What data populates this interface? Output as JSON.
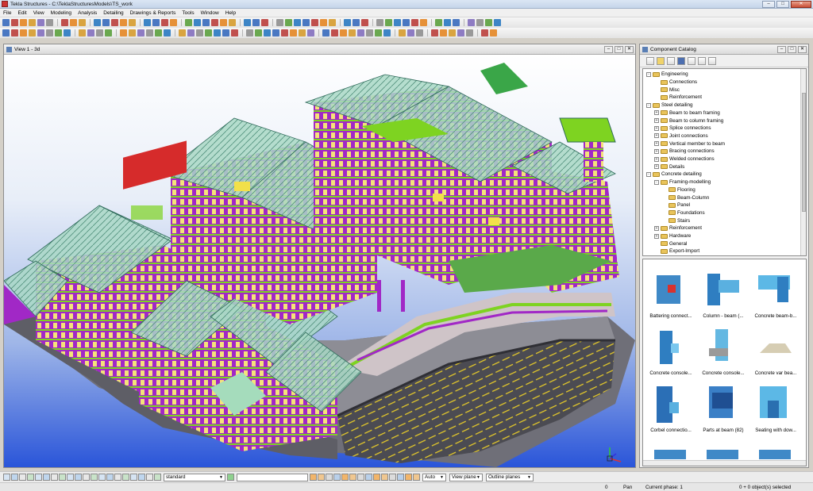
{
  "window": {
    "title": "Tekla Structures - C:\\TeklaStructuresModels\\TS_work",
    "min": "–",
    "max": "□",
    "close": "✕"
  },
  "menu": [
    "File",
    "Edit",
    "View",
    "Modeling",
    "Analysis",
    "Detailing",
    "Drawings & Reports",
    "Tools",
    "Window",
    "Help"
  ],
  "view": {
    "title": "View 1 - 3d"
  },
  "catalog": {
    "title": "Component Catalog",
    "tree": [
      {
        "label": "Engineering",
        "level": 1,
        "exp": "-"
      },
      {
        "label": "Connections",
        "level": 2,
        "exp": ""
      },
      {
        "label": "Misc",
        "level": 2,
        "exp": ""
      },
      {
        "label": "Reinforcement",
        "level": 2,
        "exp": ""
      },
      {
        "label": "Steel detailing",
        "level": 1,
        "exp": "-"
      },
      {
        "label": "Beam to beam framing",
        "level": 2,
        "exp": "+"
      },
      {
        "label": "Beam to column framing",
        "level": 2,
        "exp": "+"
      },
      {
        "label": "Splice connections",
        "level": 2,
        "exp": "+"
      },
      {
        "label": "Joint connections",
        "level": 2,
        "exp": "+"
      },
      {
        "label": "Vertical member to beam",
        "level": 2,
        "exp": "+"
      },
      {
        "label": "Bracing connections",
        "level": 2,
        "exp": "+"
      },
      {
        "label": "Welded connections",
        "level": 2,
        "exp": "+"
      },
      {
        "label": "Details",
        "level": 2,
        "exp": "+"
      },
      {
        "label": "Concrete detailing",
        "level": 1,
        "exp": "-"
      },
      {
        "label": "Framing-modelling",
        "level": 2,
        "exp": "-"
      },
      {
        "label": "Flooring",
        "level": 3,
        "exp": ""
      },
      {
        "label": "Beam-Column",
        "level": 3,
        "exp": ""
      },
      {
        "label": "Panel",
        "level": 3,
        "exp": ""
      },
      {
        "label": "Foundations",
        "level": 3,
        "exp": ""
      },
      {
        "label": "Stairs",
        "level": 3,
        "exp": ""
      },
      {
        "label": "Reinforcement",
        "level": 2,
        "exp": "+"
      },
      {
        "label": "Hardware",
        "level": 2,
        "exp": "+"
      },
      {
        "label": "General",
        "level": 2,
        "exp": ""
      },
      {
        "label": "Export-Import",
        "level": 2,
        "exp": ""
      }
    ],
    "thumbs": [
      "Battering connect...",
      "Column - beam (...",
      "Concrete beam-b...",
      "Concrete console...",
      "Concrete console...",
      "Concrete var bea...",
      "Corbel connectio...",
      "Parts at beam (82)",
      "Seating with dow..."
    ]
  },
  "bottom": {
    "select_value": "standard",
    "auto": "Auto",
    "view_plane": "View plane",
    "outline": "Outline planes"
  },
  "status": {
    "left_num": "0",
    "pan": "Pan",
    "phase": "Current phase: 1",
    "selected": "0 + 0 object(s) selected"
  },
  "colors": {
    "sky_top": "#ffffff",
    "sky_bottom": "#2a55d9",
    "magenta": "#b42ad0",
    "slab": "#8d8d95",
    "roof_glass": "#9fd6c8",
    "accent_green": "#8be01c"
  }
}
